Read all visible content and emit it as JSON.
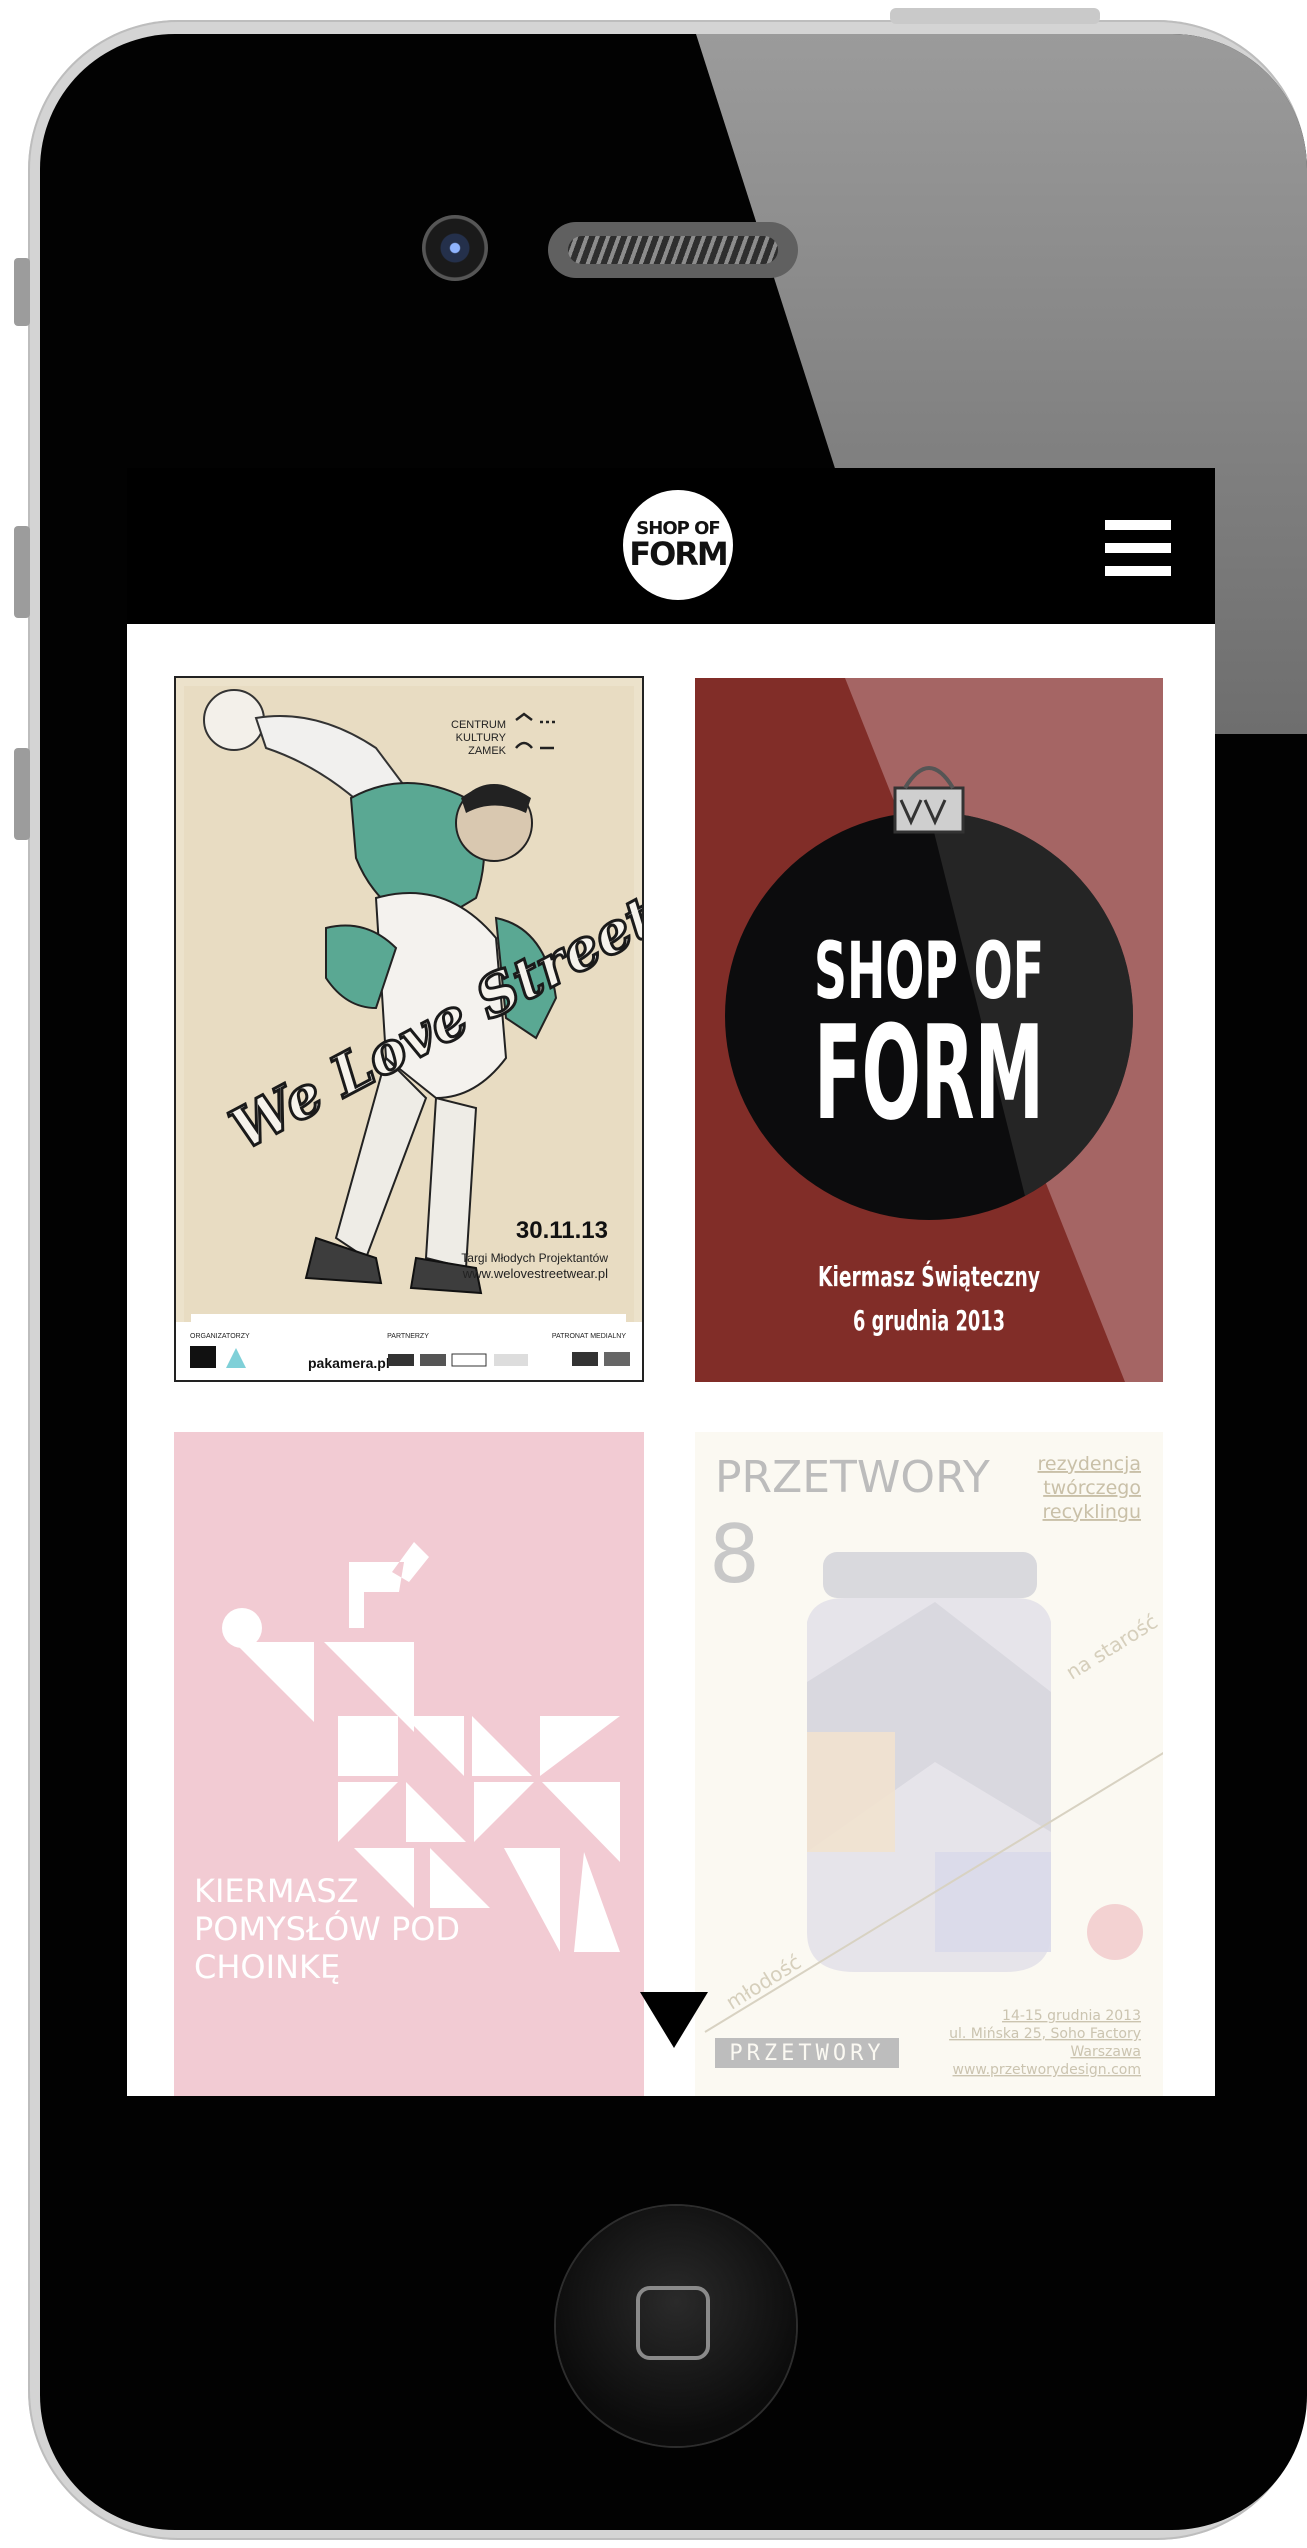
{
  "header": {
    "logo_line1": "SHOP OF",
    "logo_line2": "FORM"
  },
  "tiles": [
    {
      "id": "we-love-streetwear",
      "title": "We Love Streetwear",
      "venue": [
        "CENTRUM",
        "KULTURY",
        "ZAMEK"
      ],
      "date": "30.11.13",
      "subtitle": "Targi Młodych Projektantów",
      "url": "www.welovestreetwear.pl",
      "footer_labels": [
        "ORGANIZATORZY",
        "PARTNERZY",
        "PATRONAT MEDIALNY"
      ],
      "sponsor": "pakamera.pl"
    },
    {
      "id": "shop-of-form",
      "title_line1": "SHOP OF",
      "title_line2": "FORM",
      "event": "Kiermasz Świąteczny",
      "date": "6 grudnia 2013"
    },
    {
      "id": "kiermasz-pomyslow",
      "lines": [
        "KIERMASZ",
        "POMYSŁÓW POD",
        "CHOINKĘ"
      ]
    },
    {
      "id": "przetwory",
      "title": "PRZETWORY",
      "number": "8",
      "tagline": [
        "rezydencja",
        "twórczego",
        "recyklingu"
      ],
      "diag_left": "młodość",
      "diag_right": "na starość",
      "date": "14-15 grudnia 2013",
      "address": "ul. Mińska 25, Soho Factory",
      "city": "Warszawa",
      "url": "www.przetworydesign.com",
      "brand": "PRZETWORY"
    }
  ],
  "colors": {
    "tile_red": "#812d28",
    "tile_pink": "#f2cbd3",
    "tile_cream": "#fbf9f2",
    "poster_beige": "#ece2cb",
    "teal_accent": "#5aa893"
  }
}
